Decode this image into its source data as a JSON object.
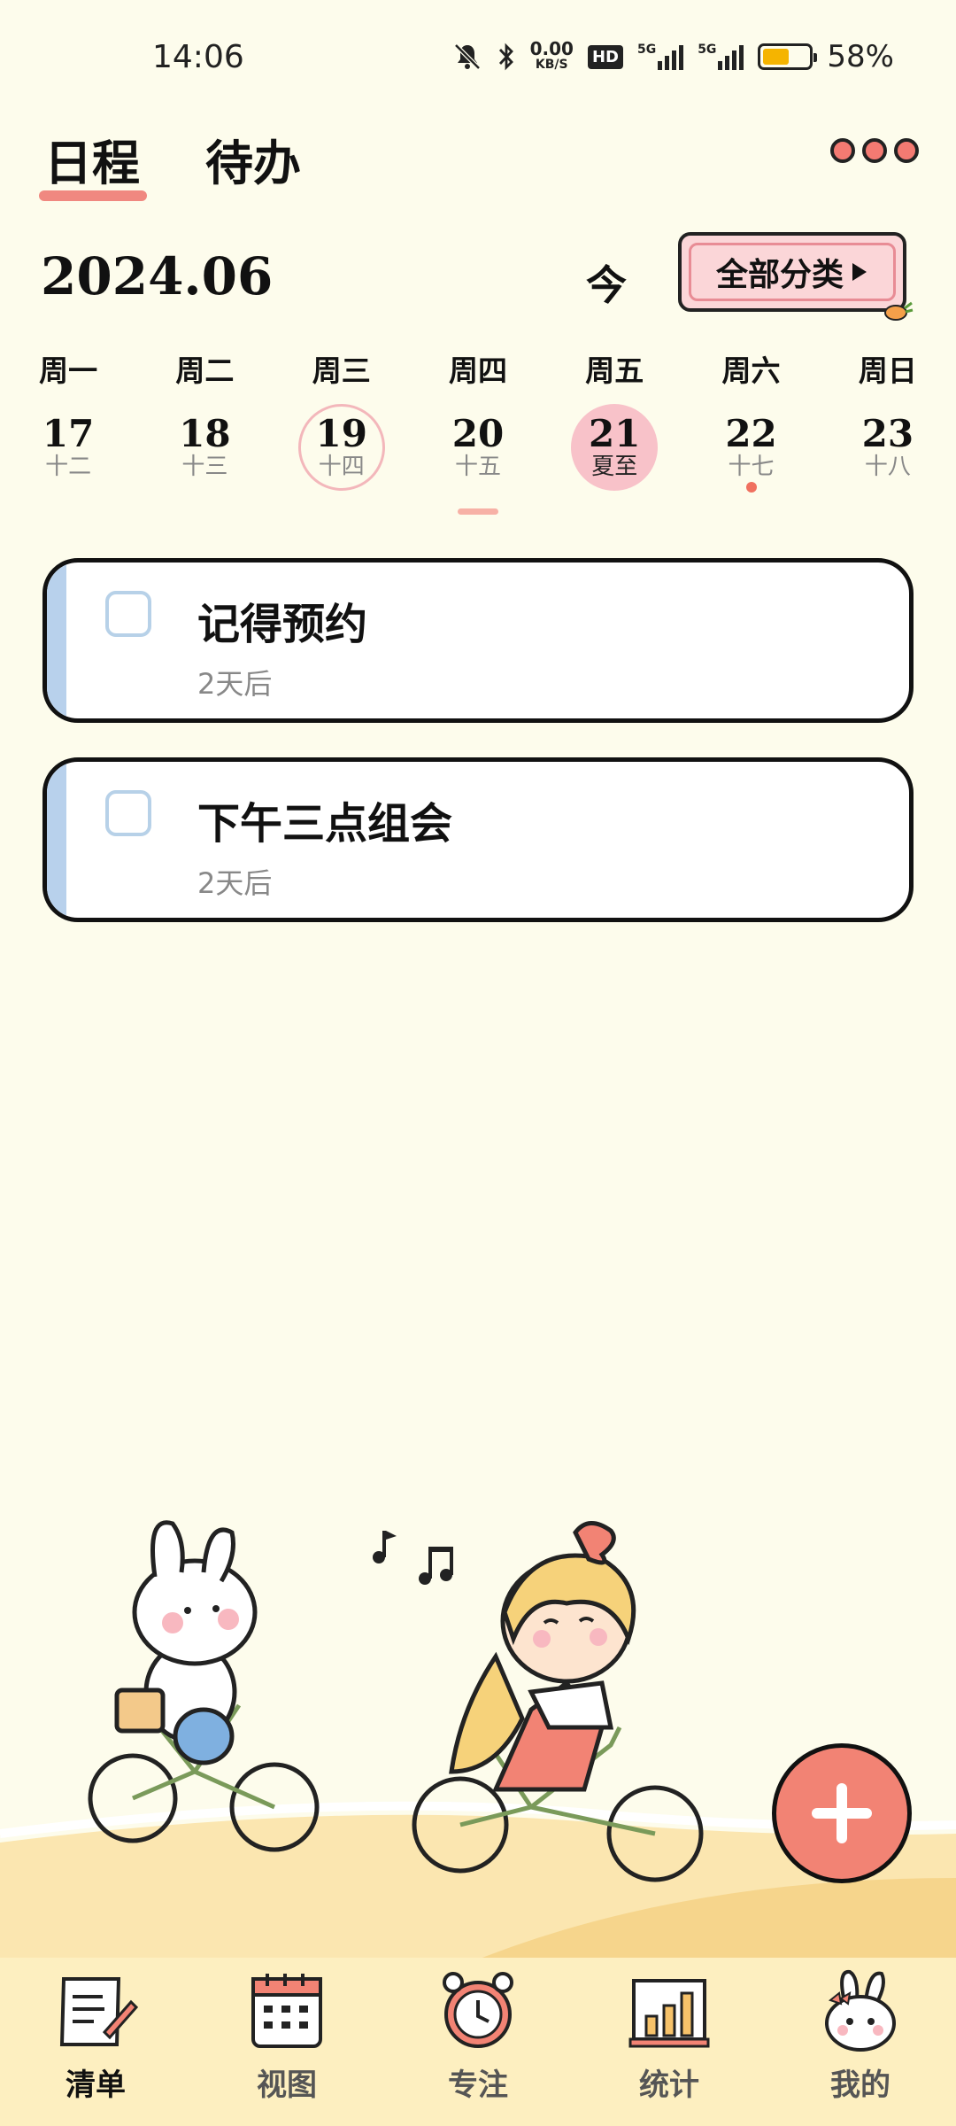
{
  "status_bar": {
    "time": "14:06",
    "net_speed_value": "0.00",
    "net_speed_unit": "KB/S",
    "hd_badge": "HD",
    "signal1_label": "5G",
    "signal2_label": "5G",
    "battery_percent": "58%",
    "battery_level": 0.58,
    "icons": [
      "mute-bell-icon",
      "bluetooth-icon",
      "signal-icon",
      "battery-icon"
    ]
  },
  "header": {
    "tabs": [
      {
        "label": "日程",
        "active": true
      },
      {
        "label": "待办",
        "active": false
      }
    ]
  },
  "toolbar": {
    "month": "2024.06",
    "today_label": "今",
    "category_label": "全部分类"
  },
  "week": {
    "labels": [
      "周一",
      "周二",
      "周三",
      "周四",
      "周五",
      "周六",
      "周日"
    ],
    "days": [
      {
        "num": "17",
        "lunar": "十二"
      },
      {
        "num": "18",
        "lunar": "十三"
      },
      {
        "num": "19",
        "lunar": "十四",
        "today": true
      },
      {
        "num": "20",
        "lunar": "十五"
      },
      {
        "num": "21",
        "lunar": "夏至",
        "selected": true
      },
      {
        "num": "22",
        "lunar": "十七",
        "has_event": true
      },
      {
        "num": "23",
        "lunar": "十八"
      }
    ]
  },
  "todos": [
    {
      "title": "记得预约",
      "due": "2天后"
    },
    {
      "title": "下午三点组会",
      "due": "2天后"
    }
  ],
  "nav": {
    "items": [
      {
        "label": "清单",
        "icon": "list-icon",
        "active": true
      },
      {
        "label": "视图",
        "icon": "calendar-icon",
        "active": false
      },
      {
        "label": "专注",
        "icon": "alarm-clock-icon",
        "active": false
      },
      {
        "label": "统计",
        "icon": "bar-chart-icon",
        "active": false
      },
      {
        "label": "我的",
        "icon": "bunny-icon",
        "active": false
      }
    ]
  },
  "colors": {
    "background": "#fdfcec",
    "accent": "#f28374",
    "selected_day": "#f8c2c9",
    "card_bar": "#b8d1ec",
    "nav_bg": "#fdefc0"
  }
}
